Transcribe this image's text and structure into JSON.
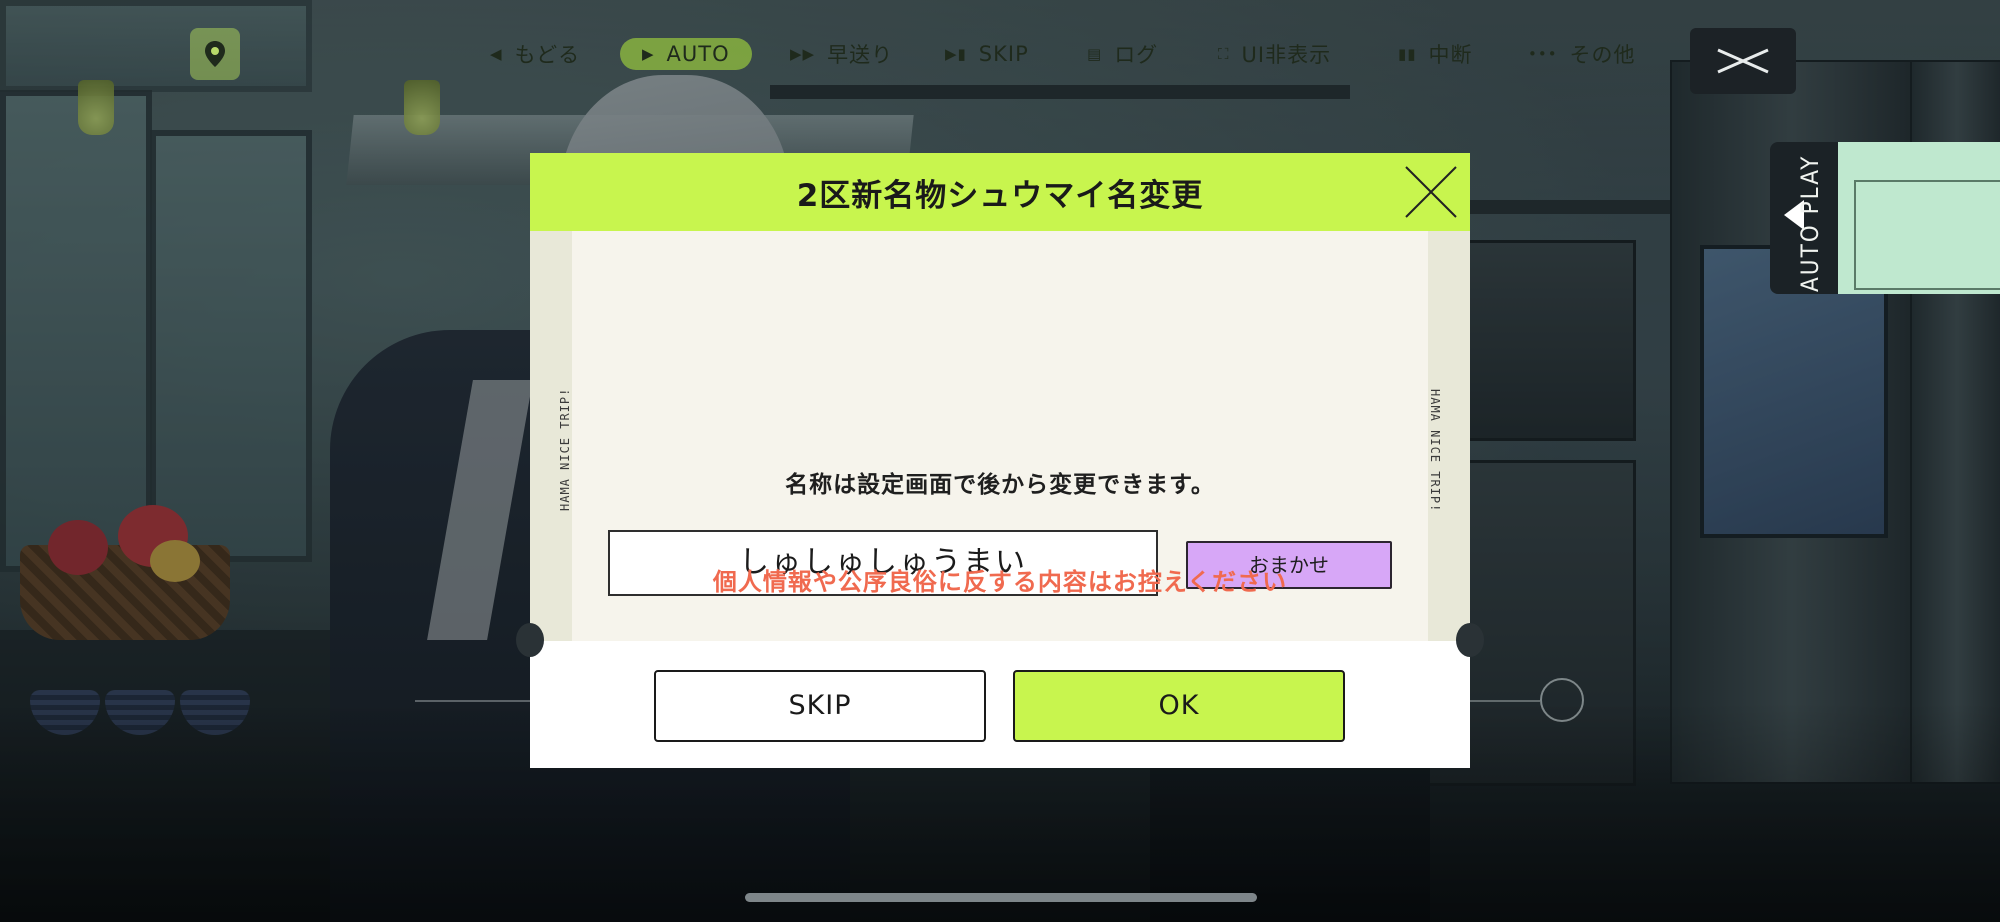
{
  "toolbar": {
    "back": "もどる",
    "auto": "AUTO",
    "fast_forward": "早送り",
    "skip": "SKIP",
    "log": "ログ",
    "hide_ui": "UI非表示",
    "pause": "中断",
    "more": "その他"
  },
  "side_tab": {
    "label": "AUTO PLAY"
  },
  "dialog": {
    "title": "2区新名物シュウマイ名変更",
    "side_text": "HAMA NICE TRIP!",
    "name_value": "しゅしゅしゅうまい",
    "omakase_label": "おまかせ",
    "note": "名称は設定画面で後から変更できます。",
    "warning": "個人情報や公序良俗に反する内容はお控えください",
    "skip_label": "SKIP",
    "ok_label": "OK"
  },
  "colors": {
    "accent_green": "#c8f54e",
    "omakase_purple": "#d7a7f7",
    "warning_red": "#f06a4f",
    "body_bg": "#f6f4ec"
  }
}
